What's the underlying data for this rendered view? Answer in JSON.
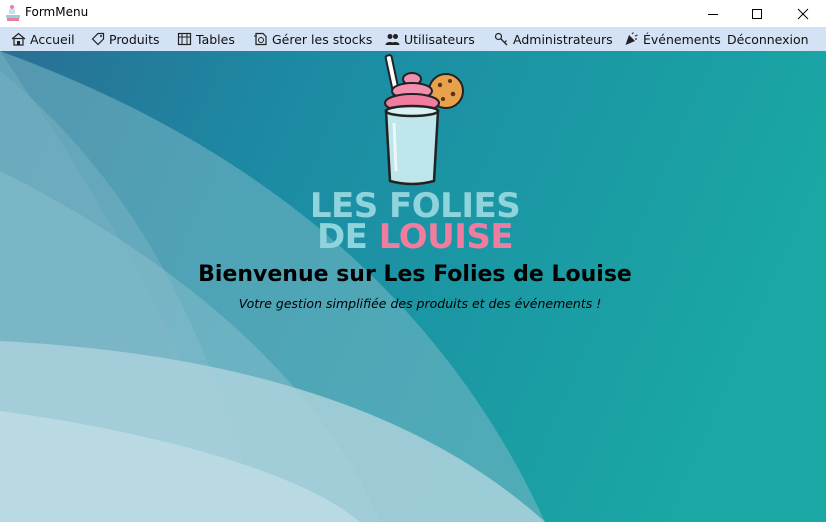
{
  "window": {
    "title": "FormMenu"
  },
  "menu": {
    "items": [
      {
        "label": "Accueil",
        "icon": "home-icon"
      },
      {
        "label": "Produits",
        "icon": "tag-icon"
      },
      {
        "label": "Tables",
        "icon": "table-icon"
      },
      {
        "label": "Gérer les stocks",
        "icon": "stock-icon"
      },
      {
        "label": "Utilisateurs",
        "icon": "users-icon"
      },
      {
        "label": "Administrateurs",
        "icon": "key-icon"
      },
      {
        "label": "Événements",
        "icon": "party-icon"
      },
      {
        "label": "Déconnexion",
        "icon": ""
      }
    ]
  },
  "logo": {
    "line1": "LES FOLIES",
    "line2_a": "DE",
    "line2_b": "LOUISE"
  },
  "welcome": {
    "heading": "Bienvenue sur Les Folies de Louise",
    "subtitle": "Votre gestion simplifiée des produits et des événements !"
  },
  "colors": {
    "menubar": "#d3e2f4",
    "background_dark": "#1d7f9c",
    "background_teal": "#1ba6a6",
    "logo_blue": "#8fd4dc",
    "logo_pink": "#f07da0"
  }
}
